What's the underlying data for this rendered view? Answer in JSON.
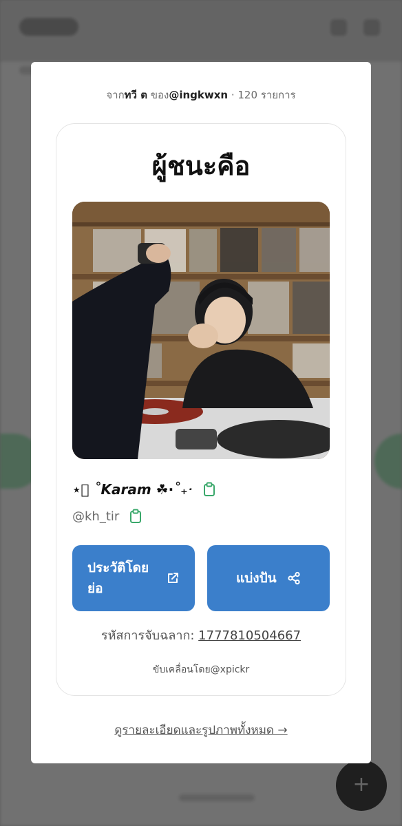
{
  "source": {
    "prefix": "จาก",
    "author": "ทวี ต",
    "mid": " ของ",
    "account": "@ingkwxn",
    "count": " · 120 รายการ"
  },
  "winner": {
    "title": "ผู้ชนะคือ",
    "name": "⋆๊ ˚Karam ☘︎⋅˚₊‧",
    "handle": "@kh_tir"
  },
  "buttons": {
    "history": "ประวัติโดยย่อ",
    "share": "แบ่งปัน"
  },
  "draw_code": {
    "label": "รหัสการจับฉลาก: ",
    "value": "1777810504667"
  },
  "powered_by": "ขับเคลื่อนโดย@xpickr",
  "view_all": "ดูรายละเอียดและรูปภาพทั้งหมด →",
  "colors": {
    "accent": "#3b7fcb",
    "copy_icon": "#3aa86b"
  },
  "icons": [
    "clipboard-icon",
    "external-link-icon",
    "share-icon"
  ]
}
